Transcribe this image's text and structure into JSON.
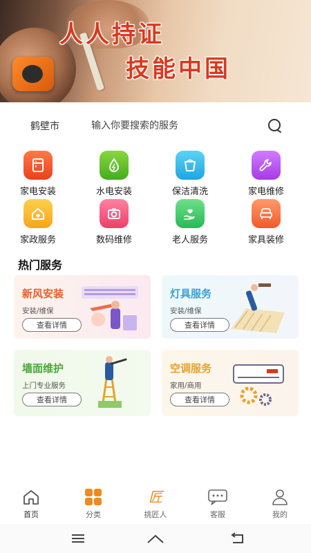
{
  "banner": {
    "line1": "人人持证",
    "line2": "技能中国"
  },
  "search": {
    "city": "鹤壁市",
    "placeholder": "输入你要搜索的服务"
  },
  "categories": [
    {
      "label": "家电安装",
      "icon": "appliance-icon",
      "color": "#f0522b"
    },
    {
      "label": "水电安装",
      "icon": "water-drop-icon",
      "color": "#5fbf2a"
    },
    {
      "label": "保洁清洗",
      "icon": "bucket-icon",
      "color": "#2fb8ea"
    },
    {
      "label": "家电维修",
      "icon": "wrench-icon",
      "color": "#b14ef0"
    },
    {
      "label": "家政服务",
      "icon": "house-icon",
      "color": "#f7b62a"
    },
    {
      "label": "数码维修",
      "icon": "camera-icon",
      "color": "#f2577d"
    },
    {
      "label": "老人服务",
      "icon": "heart-hand-icon",
      "color": "#3ec96a"
    },
    {
      "label": "家具装修",
      "icon": "sofa-icon",
      "color": "#f76a3a"
    }
  ],
  "hot": {
    "title": "热门服务",
    "cards": [
      {
        "title": "新风安装",
        "sub": "安装/维保",
        "button": "查看详情",
        "title_color": "#e8602c"
      },
      {
        "title": "灯具服务",
        "sub": "安装/维保",
        "button": "查看详情",
        "title_color": "#3aa0d8"
      },
      {
        "title": "墙面维护",
        "sub": "上门专业服务",
        "button": "查看详情",
        "title_color": "#4aa83a"
      },
      {
        "title": "空调服务",
        "sub": "家用/商用",
        "button": "查看详情",
        "title_color": "#e8a12c"
      }
    ]
  },
  "nav": [
    {
      "label": "首页",
      "icon": "home-icon"
    },
    {
      "label": "分类",
      "icon": "grid-icon"
    },
    {
      "label": "挑匠人",
      "icon": "craftsman-icon"
    },
    {
      "label": "客服",
      "icon": "chat-icon"
    },
    {
      "label": "我的",
      "icon": "person-icon"
    }
  ],
  "accent_color": "#f08a1c"
}
